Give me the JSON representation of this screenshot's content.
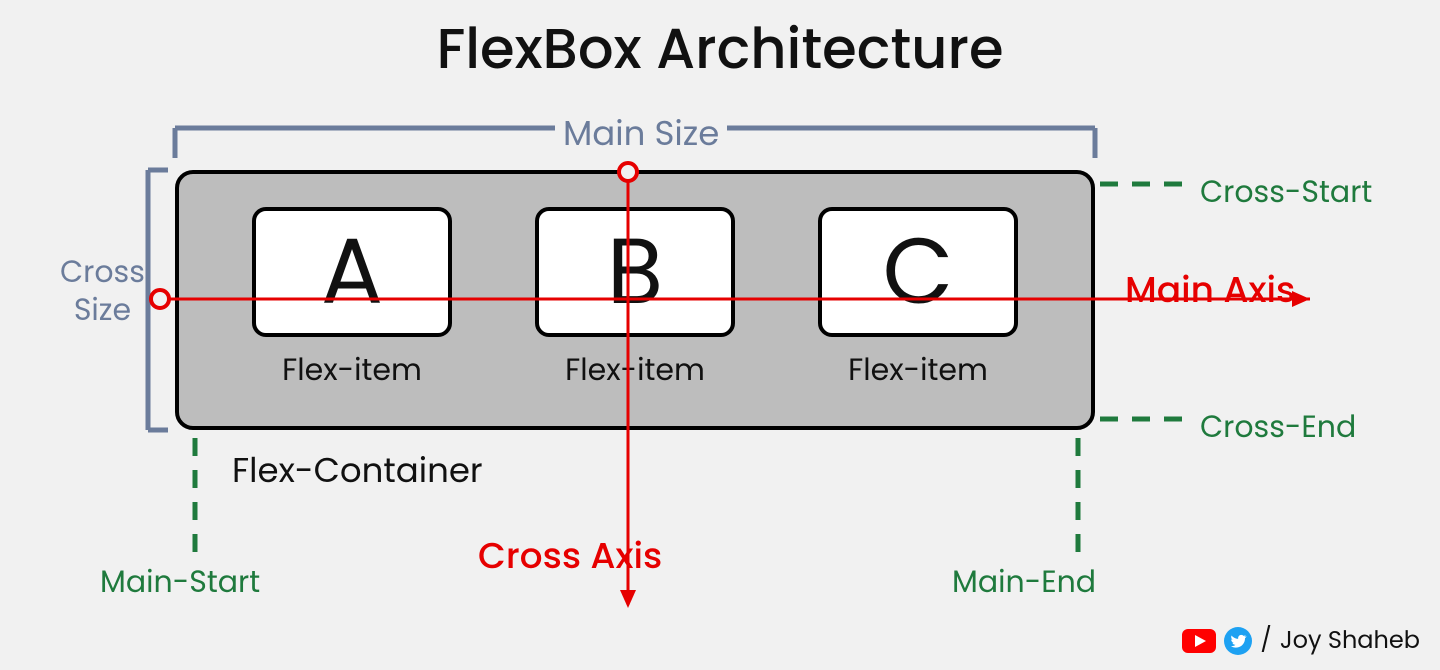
{
  "title": "FlexBox Architecture",
  "container_label": "Flex-Container",
  "item_label": "Flex-item",
  "items": {
    "a": "A",
    "b": "B",
    "c": "C"
  },
  "axes": {
    "main": "Main Axis",
    "cross": "Cross Axis"
  },
  "size_labels": {
    "main": "Main Size",
    "cross_line1": "Cross",
    "cross_line2": "Size"
  },
  "bounds": {
    "main_start": "Main-Start",
    "main_end": "Main-End",
    "cross_start": "Cross-Start",
    "cross_end": "Cross-End"
  },
  "credit": {
    "sep": "/",
    "name": "Joy Shaheb"
  },
  "colors": {
    "axis": "#e60000",
    "green": "#1f7a3d",
    "slate": "#6b7c9b"
  }
}
